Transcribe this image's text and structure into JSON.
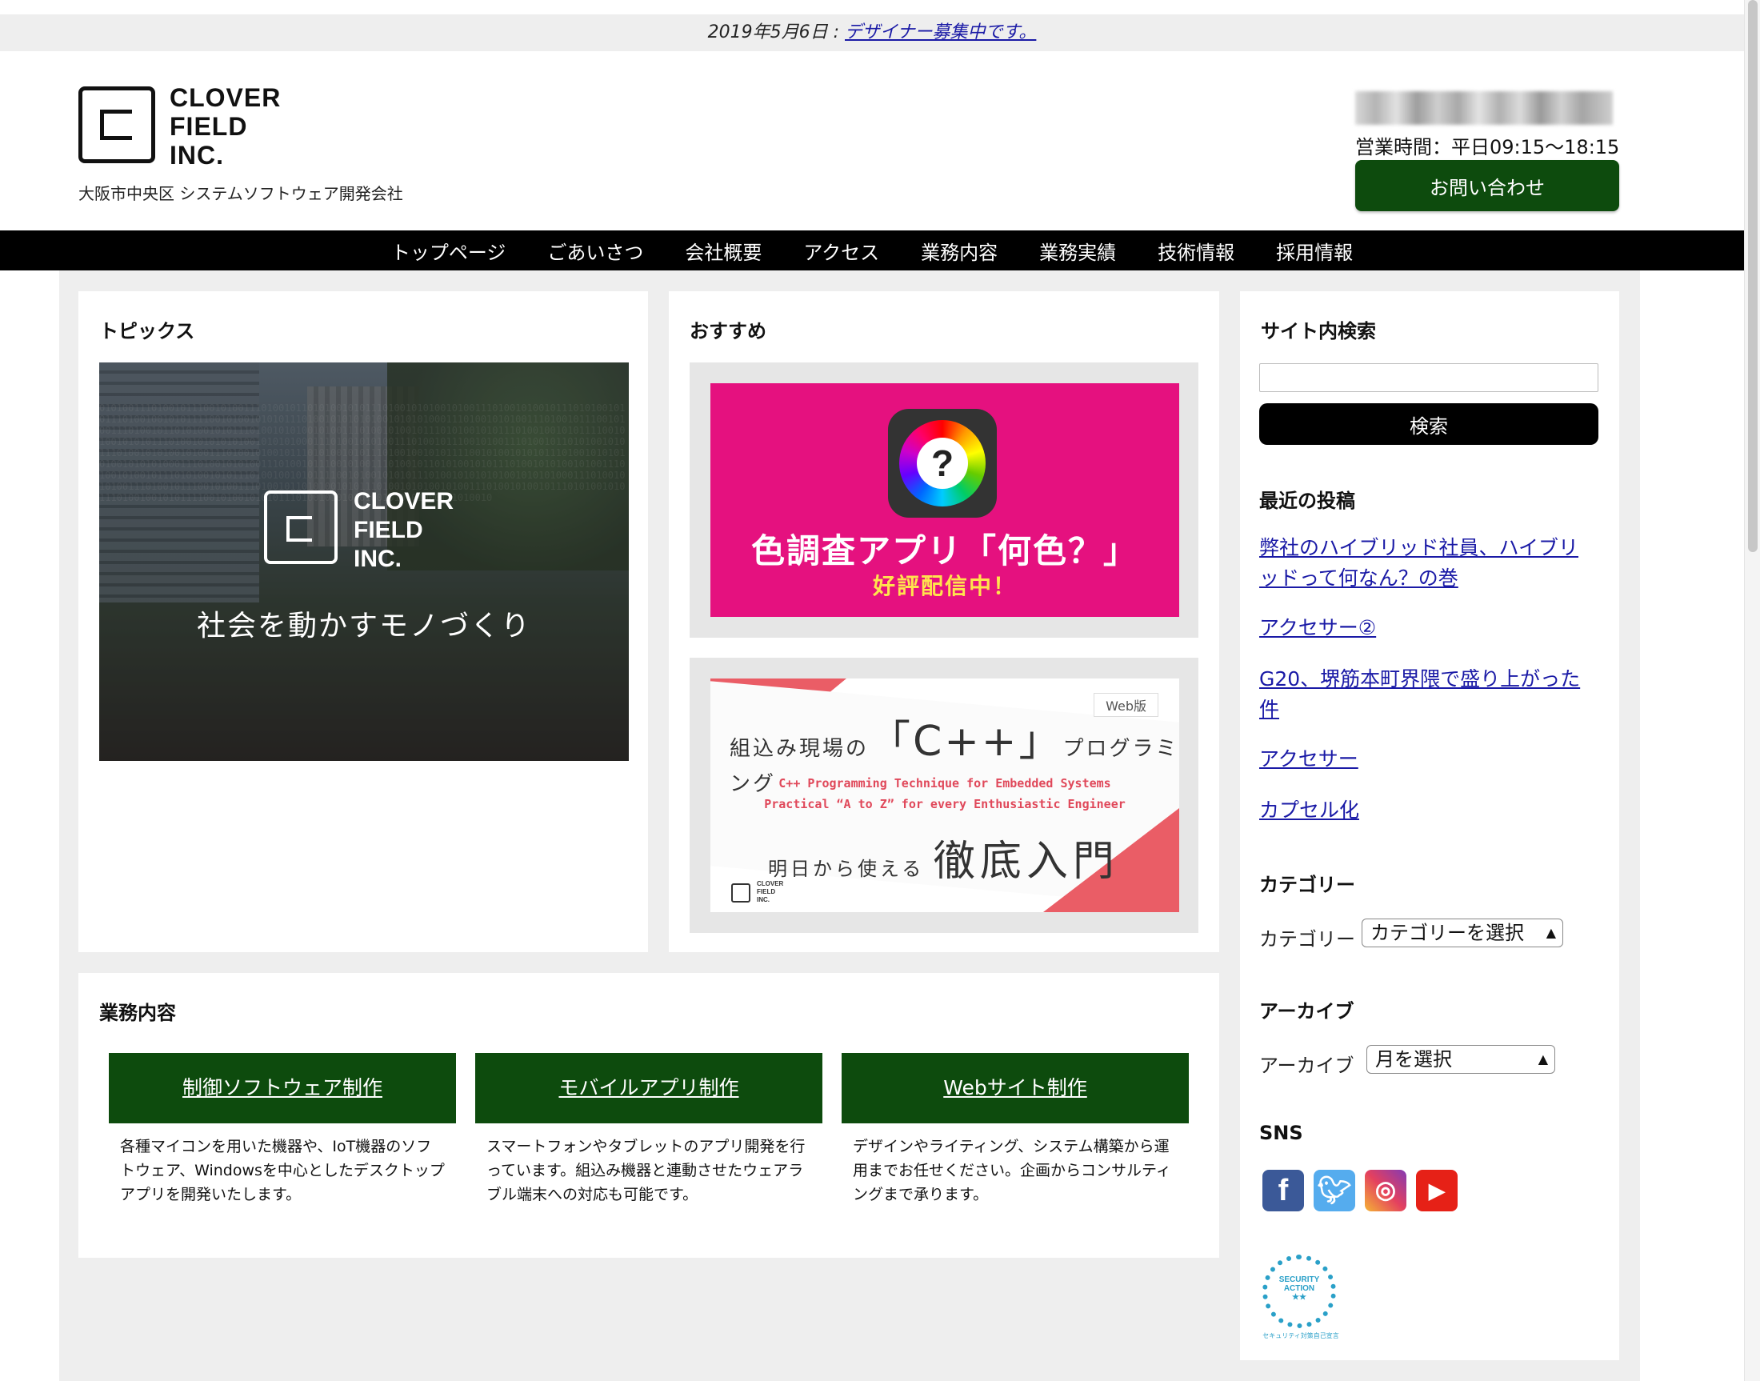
{
  "announcement": {
    "date_prefix": "2019年5月6日 : ",
    "link_text": "デザイナー募集中です。"
  },
  "header": {
    "logo_lines": [
      "CLOVER",
      "FIELD",
      "INC."
    ],
    "tagline": "大阪市中央区 システムソフトウェア開発会社",
    "hours": "営業時間：平日09:15〜18:15",
    "contact_label": "お問い合わせ"
  },
  "nav": {
    "items": [
      "トップページ",
      "ごあいさつ",
      "会社概要",
      "アクセス",
      "業務内容",
      "業務実績",
      "技術情報",
      "採用情報"
    ]
  },
  "topics": {
    "title": "トピックス",
    "image": {
      "logo_lines": [
        "CLOVER",
        "FIELD",
        "INC."
      ],
      "slogan": "社会を動かすモノづくり"
    }
  },
  "recommend": {
    "title": "おすすめ",
    "banner1": {
      "title": "色調査アプリ「何色？」",
      "subtitle": "好評配信中！",
      "icon_glyph": "?"
    },
    "banner2": {
      "badge": "Web版",
      "line1_prefix": "組込み現場の",
      "line1_big": "「C++」",
      "line1_suffix": "プログラミング",
      "en_line1": "C++ Programming Technique for Embedded Systems",
      "en_line2": "Practical “A to Z” for every Enthusiastic Engineer",
      "line3_prefix": "明日から使える",
      "line3_big": "徹底入門",
      "mini_logo": [
        "CLOVER",
        "FIELD",
        "INC."
      ]
    }
  },
  "business": {
    "title": "業務内容",
    "items": [
      {
        "title": "制御ソフトウェア制作",
        "desc": "各種マイコンを用いた機器や、IoT機器のソフトウェア、Windowsを中心としたデスクトップアプリを開発いたします。"
      },
      {
        "title": "モバイルアプリ制作",
        "desc": "スマートフォンやタブレットのアプリ開発を行っています。組込み機器と連動させたウェアラブル端末への対応も可能です。"
      },
      {
        "title": "Webサイト制作",
        "desc": "デザインやライティング、システム構築から運用までお任せください。企画からコンサルティングまで承ります。"
      }
    ]
  },
  "sidebar": {
    "search_title": "サイト内検索",
    "search_placeholder": "",
    "search_button": "検索",
    "recent_title": "最近の投稿",
    "recent_posts": [
      "弊社のハイブリッド社員、ハイブリッドって何なん？の巻",
      "アクセサー②",
      "G20、堺筋本町界隈で盛り上がった件",
      "アクセサー",
      "カプセル化"
    ],
    "category_title": "カテゴリー",
    "category_label": "カテゴリー",
    "category_selected": "カテゴリーを選択",
    "archive_title": "アーカイブ",
    "archive_label": "アーカイブ",
    "archive_selected": "月を選択",
    "sns_title": "SNS",
    "sns_icons": [
      "facebook-icon",
      "twitter-icon",
      "instagram-icon",
      "youtube-icon"
    ],
    "badge_lines": [
      "SECURITY",
      "ACTION",
      "★★"
    ],
    "badge_caption": "セキュリティ対策自己宣言"
  },
  "colors": {
    "brand_green": "#0d4b0d",
    "link": "#1a1aa6",
    "banner_pink": "#e5117f",
    "accent_red": "#ea5d66"
  }
}
